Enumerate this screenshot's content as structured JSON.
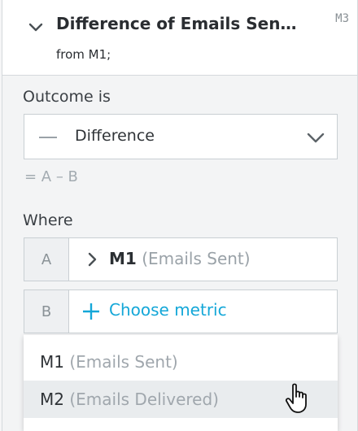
{
  "header": {
    "title": "Difference of Emails Sen…",
    "subtitle": "from M1;",
    "metric_id": "M3"
  },
  "outcome": {
    "label": "Outcome is",
    "selected": "Difference",
    "formula": "= A – B"
  },
  "where": {
    "label": "Where",
    "rows": [
      {
        "letter": "A",
        "metric_id": "M1",
        "metric_name": "(Emails Sent)"
      },
      {
        "letter": "B",
        "placeholder": "Choose metric"
      }
    ]
  },
  "dropdown": {
    "options": [
      {
        "id": "M1",
        "name": "(Emails Sent)"
      },
      {
        "id": "M2",
        "name": "(Emails Delivered)",
        "hovered": true
      }
    ]
  },
  "colors": {
    "accent": "#14a7d8",
    "muted": "#9aa2a8"
  },
  "icons": [
    "chevron-down-icon",
    "dash-icon",
    "chevron-right-icon",
    "plus-icon",
    "hand-cursor-icon"
  ]
}
